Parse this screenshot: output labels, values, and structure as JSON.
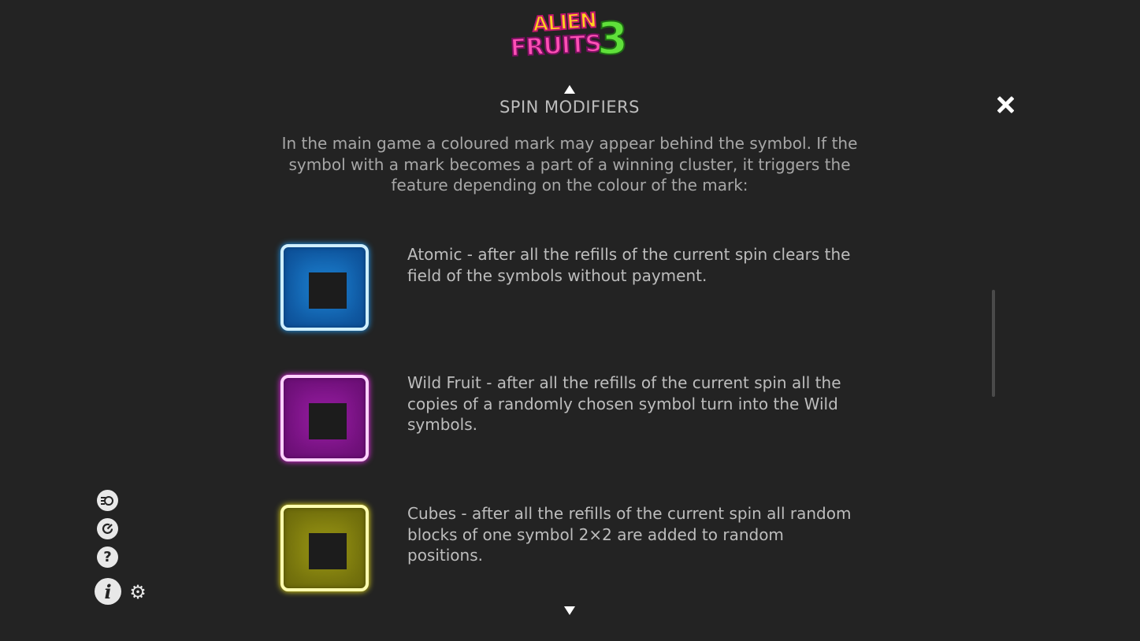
{
  "logo": {
    "line1": "ALIEN",
    "line2": "FRUITS",
    "number": "3"
  },
  "title": "SPIN MODIFIERS",
  "intro": "In the main game a coloured mark may appear behind the symbol. If the symbol with a mark becomes a part of a winning cluster, it triggers the feature depending on the colour of the mark:",
  "modifiers": [
    {
      "icon": "blue-mark-icon",
      "color": "#1fa0ff",
      "text": "Atomic - after all the refills of the current spin clears the field of the symbols without payment."
    },
    {
      "icon": "purple-mark-icon",
      "color": "#ff2cff",
      "text": "Wild Fruit - after all the refills of the current spin all the copies of a randomly chosen symbol turn into the Wild symbols."
    },
    {
      "icon": "yellow-mark-icon",
      "color": "#fff21a",
      "text": "Cubes - after all the refills of the current spin all random blocks of one symbol 2×2 are added to random positions."
    }
  ],
  "navigation": {
    "scroll_up_icon": "triangle-up-icon",
    "scroll_down_icon": "triangle-down-icon",
    "close_icon": "close-icon"
  },
  "side_menu": {
    "icons": [
      "autoplay-icon",
      "turbo-icon",
      "help-icon",
      "info-icon",
      "settings-icon"
    ],
    "help_glyph": "?",
    "info_glyph": "i",
    "gear_glyph": "⚙"
  }
}
